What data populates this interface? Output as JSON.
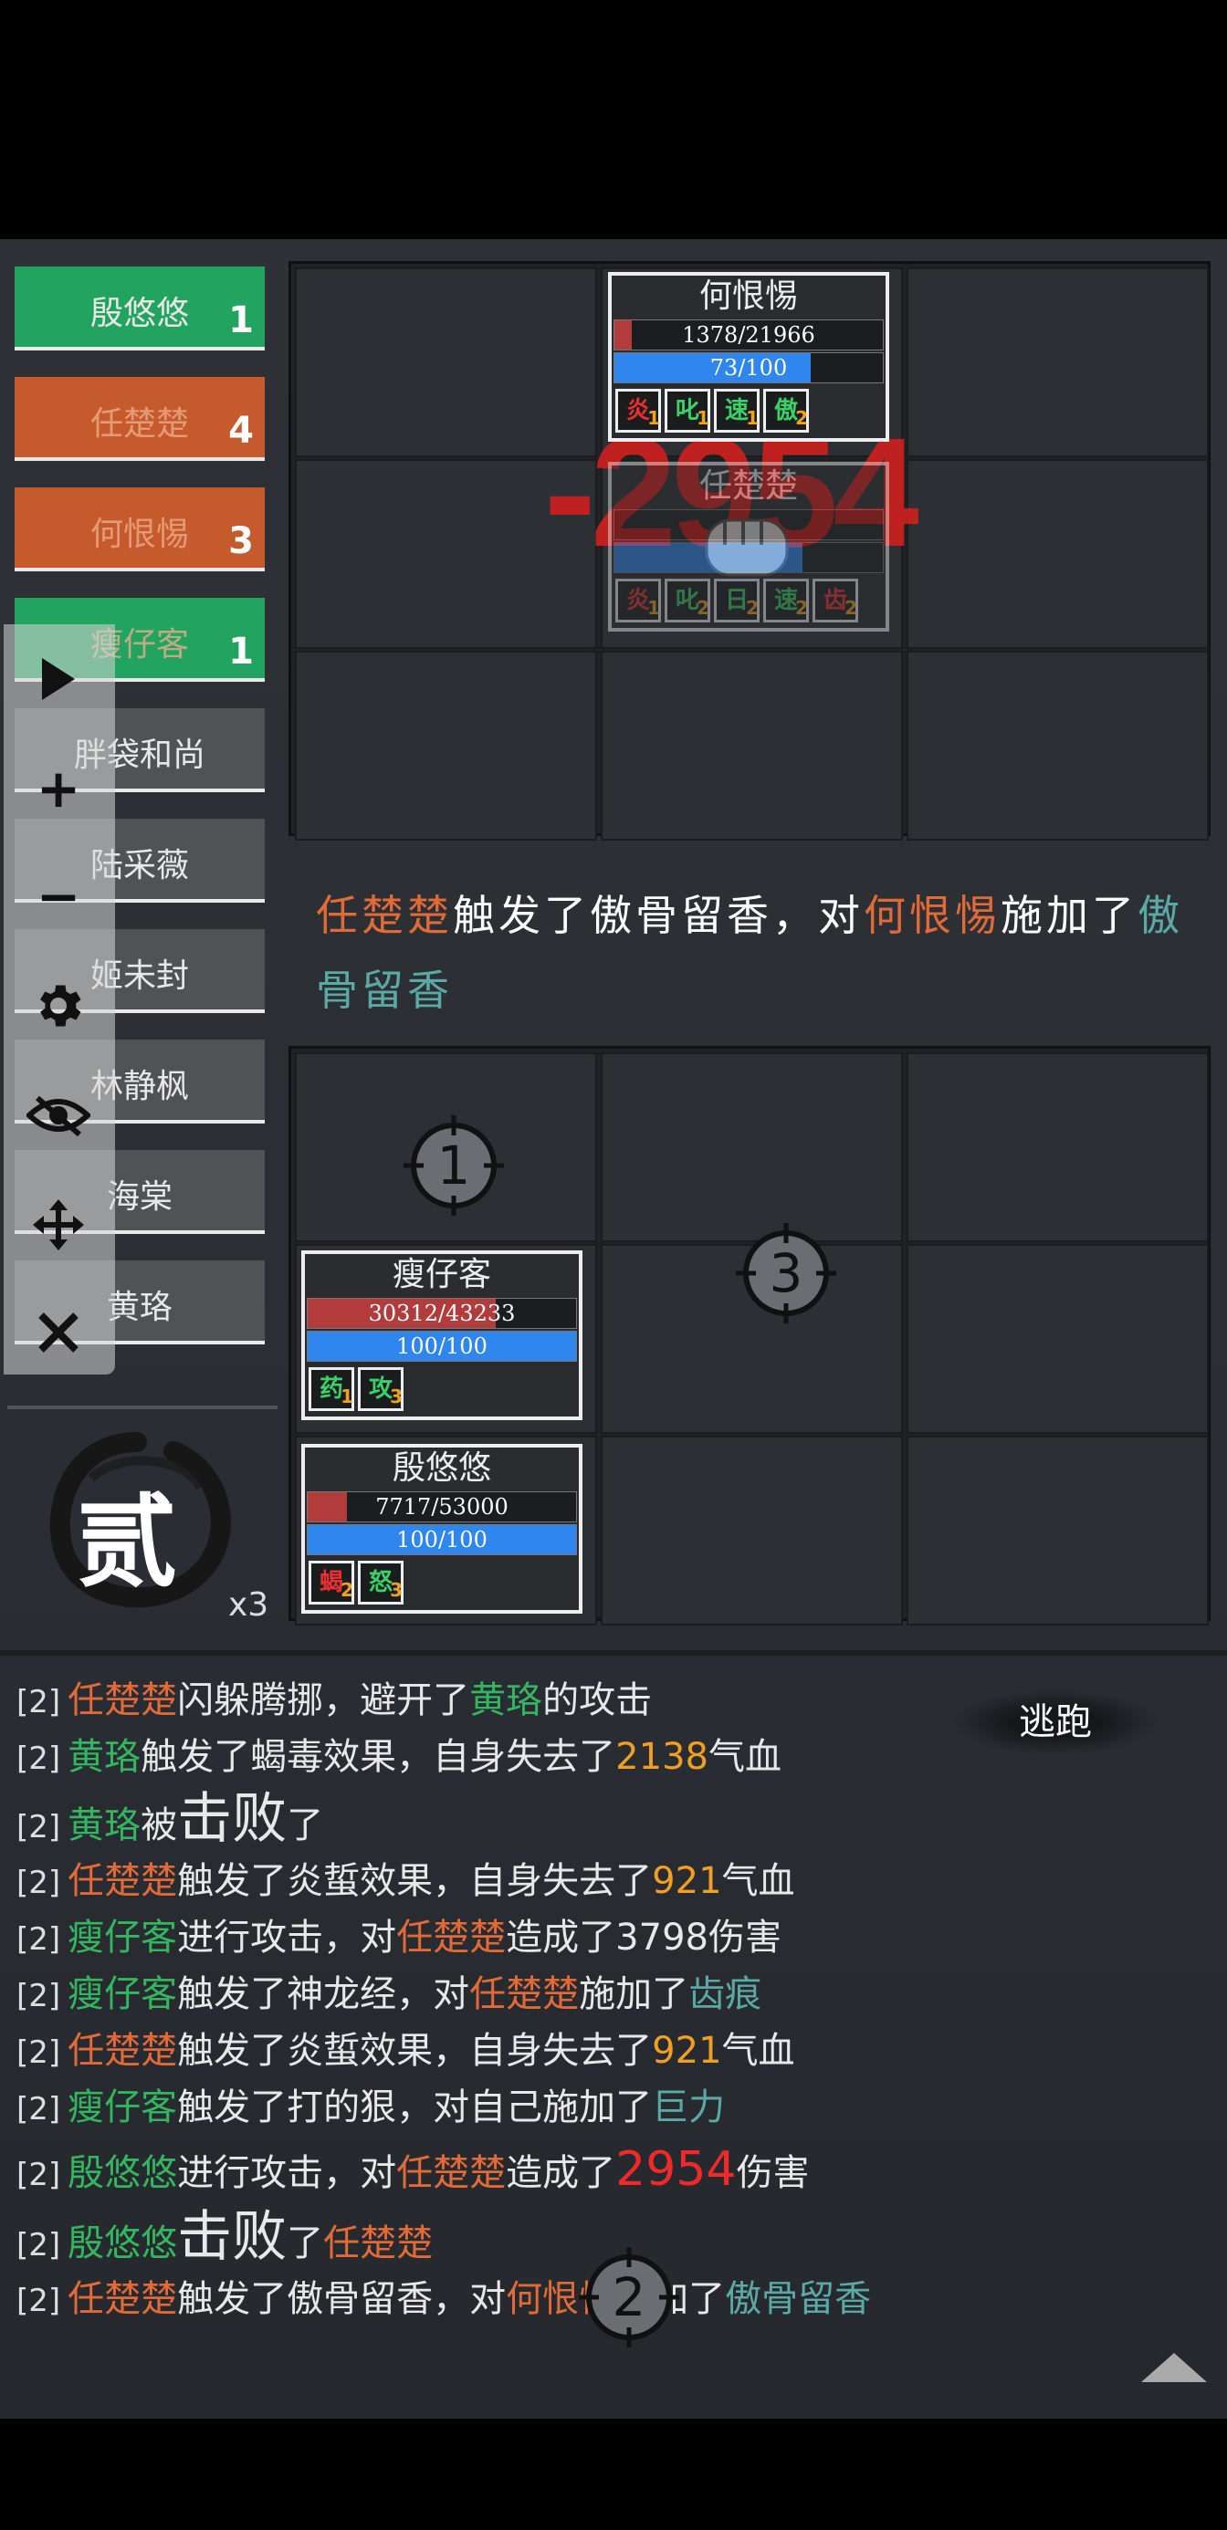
{
  "turn_order": [
    {
      "name": "殷悠悠",
      "count": "1",
      "style": "green"
    },
    {
      "name": "任楚楚",
      "count": "4",
      "style": "orange"
    },
    {
      "name": "何恨惕",
      "count": "3",
      "style": "orange"
    },
    {
      "name": "瘦仔客",
      "count": "1",
      "style": "green"
    },
    {
      "name": "胖袋和尚",
      "count": "",
      "style": "gray"
    },
    {
      "name": "陆采薇",
      "count": "",
      "style": "gray"
    },
    {
      "name": "姬未封",
      "count": "",
      "style": "gray"
    },
    {
      "name": "林静枫",
      "count": "",
      "style": "gray"
    },
    {
      "name": "海棠",
      "count": "",
      "style": "gray"
    },
    {
      "name": "黄珞",
      "count": "",
      "style": "gray"
    }
  ],
  "controls": {
    "play": "▶",
    "plus": "+",
    "minus": "−",
    "settings": "⚙",
    "eye": "👁",
    "move": "✥",
    "close": "✕"
  },
  "round": {
    "label": "贰",
    "multiplier": "x3"
  },
  "enemy_units": [
    {
      "name": "何恨惕",
      "hp": "1378/21966",
      "hp_ratio": 0.063,
      "mp": "73/100",
      "mp_ratio": 0.73,
      "buffs": [
        {
          "t": "炎",
          "n": "1",
          "c": "#e83030"
        },
        {
          "t": "叱",
          "n": "1",
          "c": "#3ad06a"
        },
        {
          "t": "速",
          "n": "1",
          "c": "#3ad06a"
        },
        {
          "t": "傲",
          "n": "2",
          "c": "#3ad06a"
        }
      ]
    },
    {
      "name": "任楚楚",
      "hp": "",
      "hp_ratio": 0.0,
      "mp": "",
      "mp_ratio": 0.7,
      "buffs": [
        {
          "t": "炎",
          "n": "1",
          "c": "#e83030"
        },
        {
          "t": "叱",
          "n": "2",
          "c": "#3ad06a"
        },
        {
          "t": "日",
          "n": "2",
          "c": "#3ad06a"
        },
        {
          "t": "速",
          "n": "2",
          "c": "#3ad06a"
        },
        {
          "t": "齿",
          "n": "2",
          "c": "#e83030"
        }
      ]
    }
  ],
  "damage_popup": "-2954",
  "message": {
    "actor": "任楚楚",
    "text1": "触发了傲骨留香，对",
    "target": "何恨惕",
    "text2": "施加了",
    "effect": "傲骨留香"
  },
  "ally_units": [
    {
      "name": "瘦仔客",
      "hp": "30312/43233",
      "hp_ratio": 0.7,
      "mp": "100/100",
      "mp_ratio": 1.0,
      "buffs": [
        {
          "t": "药",
          "n": "1",
          "c": "#3ad06a"
        },
        {
          "t": "攻",
          "n": "3",
          "c": "#3ad06a"
        }
      ]
    },
    {
      "name": "殷悠悠",
      "hp": "7717/53000",
      "hp_ratio": 0.145,
      "mp": "100/100",
      "mp_ratio": 1.0,
      "buffs": [
        {
          "t": "蝎",
          "n": "2",
          "c": "#e83030"
        },
        {
          "t": "怒",
          "n": "3",
          "c": "#3ad06a"
        }
      ]
    }
  ],
  "markers": [
    "1",
    "3",
    "2"
  ],
  "flee_label": "逃跑",
  "log": [
    {
      "p": "[2]",
      "segs": [
        {
          "t": "任楚楚",
          "c": "orange"
        },
        {
          "t": "闪躲腾挪，避开了"
        },
        {
          "t": "黄珞",
          "c": "green"
        },
        {
          "t": "的攻击"
        }
      ]
    },
    {
      "p": "[2]",
      "segs": [
        {
          "t": "黄珞",
          "c": "green"
        },
        {
          "t": "触发了蝎毒效果，自身失去了"
        },
        {
          "t": "2138",
          "c": "gold"
        },
        {
          "t": "气血"
        }
      ]
    },
    {
      "p": "[2]",
      "segs": [
        {
          "t": "黄珞",
          "c": "green"
        },
        {
          "t": "被"
        },
        {
          "t": "击败",
          "c": "big"
        },
        {
          "t": "了"
        }
      ]
    },
    {
      "p": "[2]",
      "segs": [
        {
          "t": "任楚楚",
          "c": "orange"
        },
        {
          "t": "触发了炎蜇效果，自身失去了"
        },
        {
          "t": "921",
          "c": "gold"
        },
        {
          "t": "气血"
        }
      ]
    },
    {
      "p": "[2]",
      "segs": [
        {
          "t": "瘦仔客",
          "c": "green"
        },
        {
          "t": "进行攻击，对"
        },
        {
          "t": "任楚楚",
          "c": "orange"
        },
        {
          "t": "造成了3798伤害"
        }
      ]
    },
    {
      "p": "[2]",
      "segs": [
        {
          "t": "瘦仔客",
          "c": "green"
        },
        {
          "t": "触发了神龙经，对"
        },
        {
          "t": "任楚楚",
          "c": "orange"
        },
        {
          "t": "施加了"
        },
        {
          "t": "齿痕",
          "c": "teal"
        }
      ]
    },
    {
      "p": "[2]",
      "segs": [
        {
          "t": "任楚楚",
          "c": "orange"
        },
        {
          "t": "触发了炎蜇效果，自身失去了"
        },
        {
          "t": "921",
          "c": "gold"
        },
        {
          "t": "气血"
        }
      ]
    },
    {
      "p": "[2]",
      "segs": [
        {
          "t": "瘦仔客",
          "c": "green"
        },
        {
          "t": "触发了打的狠，对自己施加了"
        },
        {
          "t": "巨力",
          "c": "teal"
        }
      ]
    },
    {
      "p": "[2]",
      "segs": [
        {
          "t": "殷悠悠",
          "c": "green"
        },
        {
          "t": "进行攻击，对"
        },
        {
          "t": "任楚楚",
          "c": "orange"
        },
        {
          "t": "造成了"
        },
        {
          "t": "2954",
          "c": "red"
        },
        {
          "t": "伤害"
        }
      ]
    },
    {
      "p": "[2]",
      "segs": [
        {
          "t": "殷悠悠",
          "c": "green"
        },
        {
          "t": "击败",
          "c": "big"
        },
        {
          "t": "了"
        },
        {
          "t": "任楚楚",
          "c": "orange"
        }
      ]
    },
    {
      "p": "[2]",
      "segs": [
        {
          "t": "任楚楚",
          "c": "orange"
        },
        {
          "t": "触发了傲骨留香，对"
        },
        {
          "t": "何恨惕",
          "c": "orange"
        },
        {
          "t": "施加了"
        },
        {
          "t": "傲骨留香",
          "c": "teal"
        }
      ]
    }
  ]
}
